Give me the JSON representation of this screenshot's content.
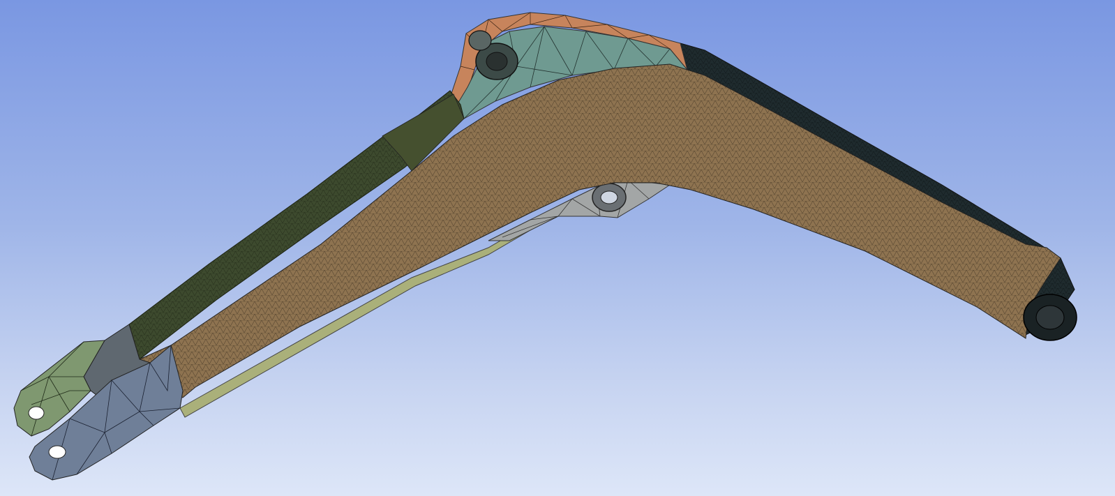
{
  "viewport": {
    "background_top": "#7a97e2",
    "background_bottom": "#dde6f8"
  },
  "model": {
    "description_icon": "mesh-boom-icon",
    "colors": {
      "main_body": "#8e7350",
      "top_plate": "#1f2b2e",
      "upper_bracket_plate": "#c7845c",
      "upper_bracket_side": "#6f9a91",
      "lower_bracket": "#a3a6a6",
      "left_upper_plate": "#3d4a2e",
      "tip_left_ear": "#7f9870",
      "tip_right_ear": "#6f7f98",
      "tip_block": "#5f6870",
      "bottom_strip": "#aab07a",
      "mesh_line": "#2a2a2a"
    }
  }
}
